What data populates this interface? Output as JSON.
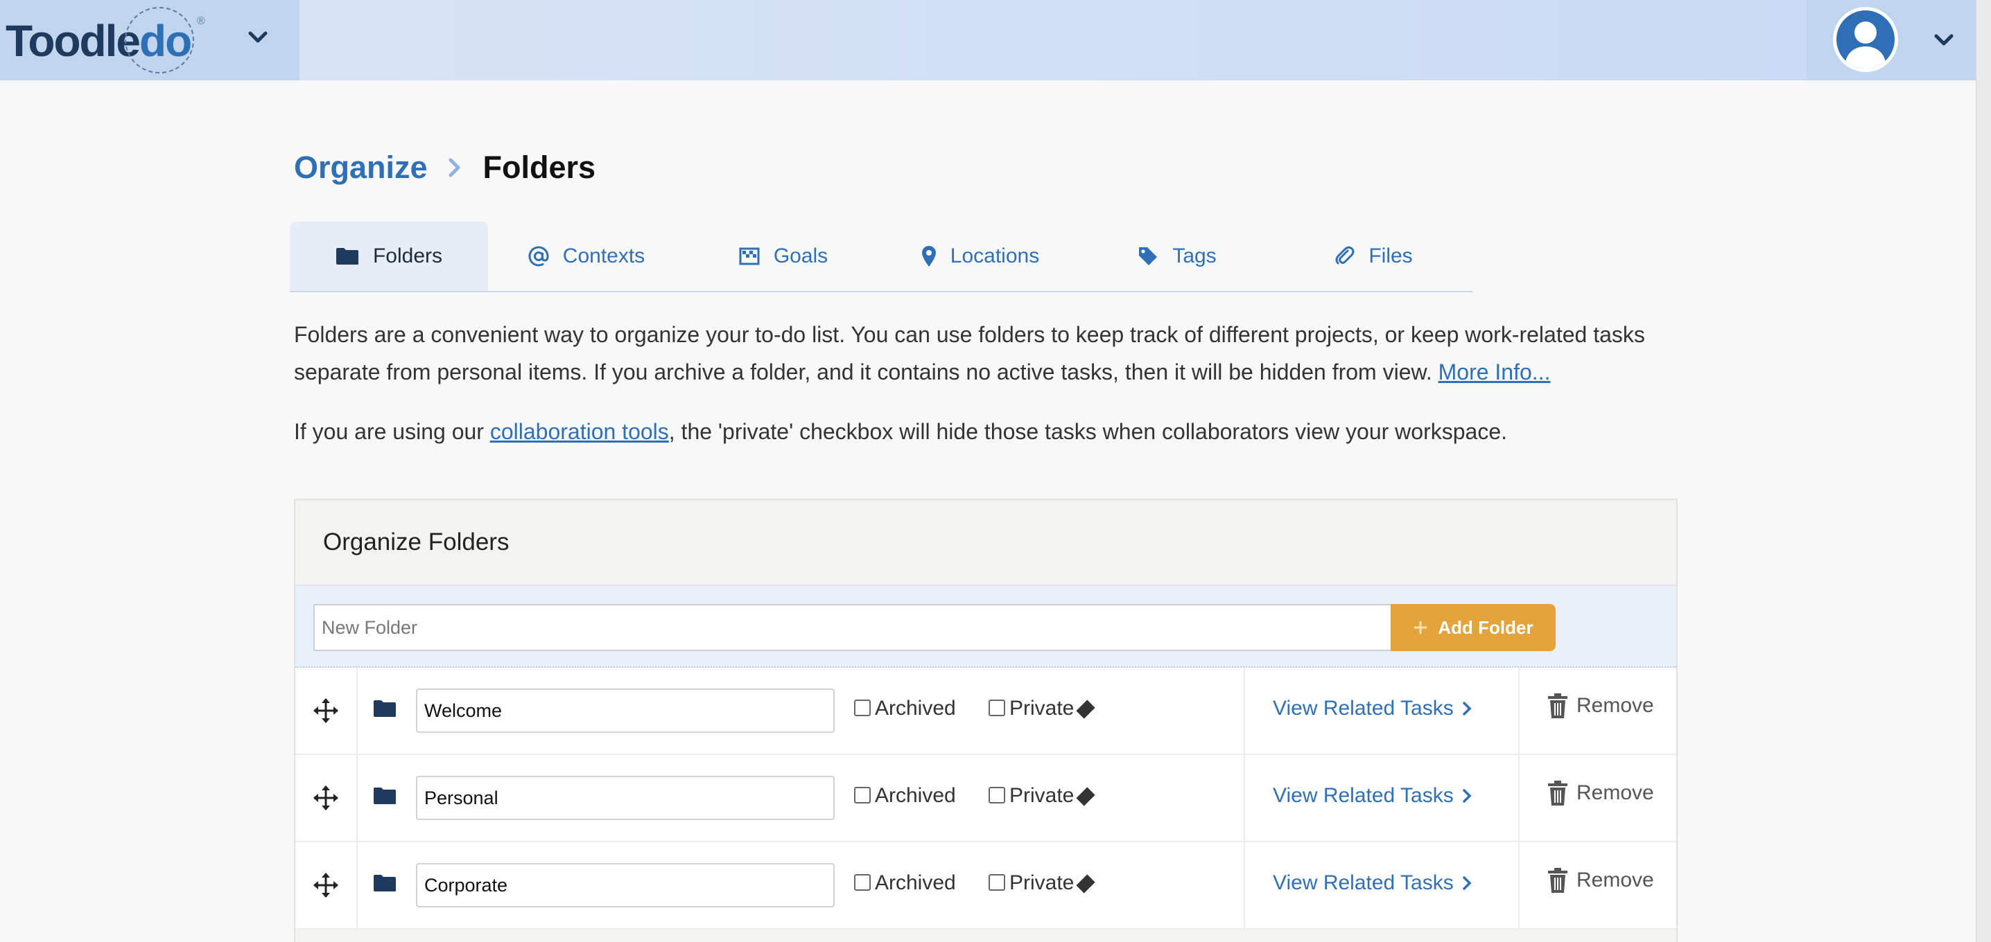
{
  "header": {
    "logo_text_dark": "Toodle",
    "logo_text_blue": "do",
    "logo_reg": "®"
  },
  "breadcrumb": {
    "parent": "Organize",
    "current": "Folders"
  },
  "tabs": [
    {
      "label": "Folders",
      "icon": "folder-icon",
      "active": true
    },
    {
      "label": "Contexts",
      "icon": "at-icon",
      "active": false
    },
    {
      "label": "Goals",
      "icon": "goal-icon",
      "active": false
    },
    {
      "label": "Locations",
      "icon": "map-pin-icon",
      "active": false
    },
    {
      "label": "Tags",
      "icon": "tag-icon",
      "active": false
    },
    {
      "label": "Files",
      "icon": "paperclip-icon",
      "active": false
    }
  ],
  "description": {
    "text": "Folders are a convenient way to organize your to-do list. You can use folders to keep track of different projects, or keep work-related tasks separate from personal items. If you archive a folder, and it contains no active tasks, then it will be hidden from view. ",
    "more_info": "More Info...",
    "collab_prefix": "If you are using our ",
    "collab_link": "collaboration tools",
    "collab_suffix": ", the 'private' checkbox will hide those tasks when collaborators view your workspace."
  },
  "panel": {
    "title": "Organize Folders",
    "new_folder_placeholder": "New Folder",
    "add_button": "Add Folder",
    "archived_label": "Archived",
    "private_label": "Private",
    "view_label": "View Related Tasks",
    "remove_label": "Remove",
    "folders": [
      {
        "name": "Welcome",
        "archived": false,
        "private": false
      },
      {
        "name": "Personal",
        "archived": false,
        "private": false
      },
      {
        "name": "Corporate",
        "archived": false,
        "private": false
      }
    ]
  },
  "colors": {
    "accent": "#2f6fb5",
    "add_button": "#e2a43b",
    "topbar": "#c9daf5"
  }
}
